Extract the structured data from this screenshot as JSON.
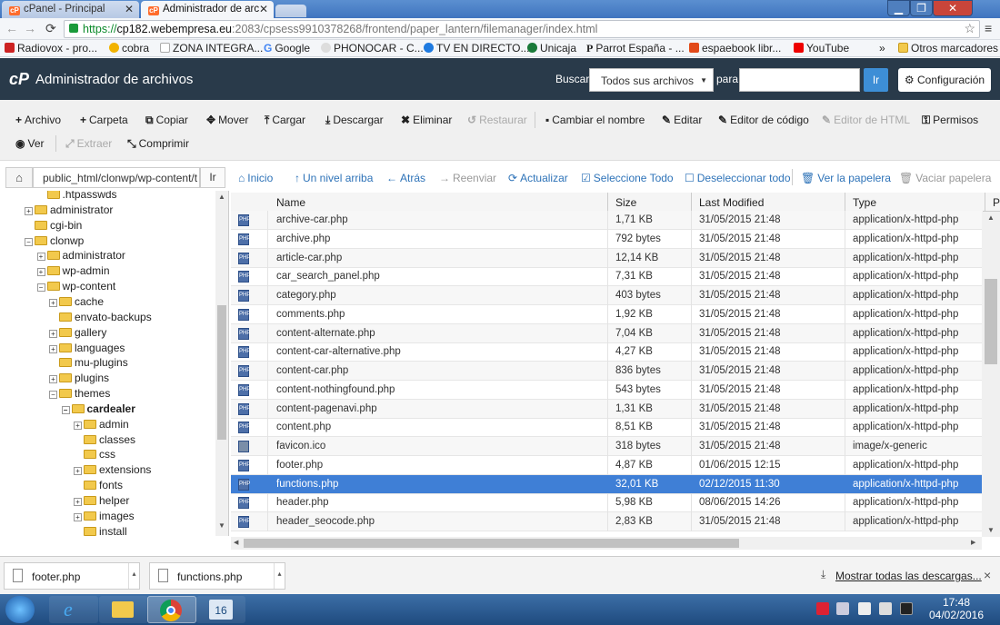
{
  "browser": {
    "tabs": [
      {
        "label": "cPanel - Principal",
        "favicon": "cP"
      },
      {
        "label": "Administrador de arc",
        "favicon": "cP"
      }
    ],
    "url_secure": "https://",
    "url_host": "cp182.webempresa.eu",
    "url_rest": ":2083/cpsess9910378268/frontend/paper_lantern/filemanager/index.html",
    "bookmarks": [
      "Radiovox - pro...",
      "cobra",
      "ZONA INTEGRA...",
      "Google",
      "PHONOCAR - C...",
      "TV EN DIRECTO...",
      "Unicaja",
      "Parrot España - ...",
      "espaebook libr...",
      "YouTube"
    ],
    "bookmarks_more": "»",
    "other_bookmarks": "Otros marcadores"
  },
  "cpanel": {
    "logo": "cP",
    "title": "Administrador de archivos",
    "search_label": "Buscar",
    "search_scope": "Todos sus archivos",
    "for_label": "para",
    "go_label": "Ir",
    "settings_label": "Configuración"
  },
  "toolbar": {
    "row1": [
      {
        "icon": "+",
        "label": "Archivo"
      },
      {
        "icon": "+",
        "label": "Carpeta"
      },
      {
        "icon": "⧉",
        "label": "Copiar"
      },
      {
        "icon": "✥",
        "label": "Mover"
      },
      {
        "icon": "⤒",
        "label": "Cargar"
      },
      {
        "icon": "⤓",
        "label": "Descargar"
      },
      {
        "icon": "✖",
        "label": "Eliminar"
      },
      {
        "icon": "↺",
        "label": "Restaurar"
      },
      {
        "icon": "▪",
        "label": "Cambiar el nombre"
      },
      {
        "icon": "✎",
        "label": "Editar"
      },
      {
        "icon": "✎",
        "label": "Editor de código"
      },
      {
        "icon": "✎",
        "label": "Editor de HTML"
      },
      {
        "icon": "⚿",
        "label": "Permisos"
      }
    ],
    "row2": [
      {
        "icon": "◉",
        "label": "Ver"
      },
      {
        "icon": "⤢",
        "label": "Extraer"
      },
      {
        "icon": "⤡",
        "label": "Comprimir"
      }
    ]
  },
  "pathbar": {
    "home_icon": "⌂",
    "path": "public_html/clonwp/wp-content/t",
    "go_label": "Ir",
    "nav": [
      {
        "icon": "⌂",
        "label": "Inicio"
      },
      {
        "icon": "↑",
        "label": "Un nivel arriba"
      },
      {
        "icon": "←",
        "label": "Atrás"
      },
      {
        "icon": "→",
        "label": "Reenviar"
      },
      {
        "icon": "⟳",
        "label": "Actualizar"
      },
      {
        "icon": "☑",
        "label": "Seleccione Todo"
      },
      {
        "icon": "☐",
        "label": "Deseleccionar todo"
      },
      {
        "icon": "🗑",
        "label": "Ver la papelera"
      },
      {
        "icon": "🗑",
        "label": "Vaciar papelera"
      }
    ]
  },
  "tree": [
    {
      "label": ".htpasswds",
      "depth": 3,
      "toggle": ""
    },
    {
      "label": "administrator",
      "depth": 2,
      "toggle": "+"
    },
    {
      "label": "cgi-bin",
      "depth": 2,
      "toggle": ""
    },
    {
      "label": "clonwp",
      "depth": 2,
      "toggle": "−"
    },
    {
      "label": "administrator",
      "depth": 3,
      "toggle": "+"
    },
    {
      "label": "wp-admin",
      "depth": 3,
      "toggle": "+"
    },
    {
      "label": "wp-content",
      "depth": 3,
      "toggle": "−"
    },
    {
      "label": "cache",
      "depth": 4,
      "toggle": "+"
    },
    {
      "label": "envato-backups",
      "depth": 4,
      "toggle": ""
    },
    {
      "label": "gallery",
      "depth": 4,
      "toggle": "+"
    },
    {
      "label": "languages",
      "depth": 4,
      "toggle": "+"
    },
    {
      "label": "mu-plugins",
      "depth": 4,
      "toggle": ""
    },
    {
      "label": "plugins",
      "depth": 4,
      "toggle": "+"
    },
    {
      "label": "themes",
      "depth": 4,
      "toggle": "−"
    },
    {
      "label": "cardealer",
      "depth": 5,
      "toggle": "−",
      "bold": true
    },
    {
      "label": "admin",
      "depth": 6,
      "toggle": "+"
    },
    {
      "label": "classes",
      "depth": 6,
      "toggle": ""
    },
    {
      "label": "css",
      "depth": 6,
      "toggle": ""
    },
    {
      "label": "extensions",
      "depth": 6,
      "toggle": "+"
    },
    {
      "label": "fonts",
      "depth": 6,
      "toggle": ""
    },
    {
      "label": "helper",
      "depth": 6,
      "toggle": "+"
    },
    {
      "label": "images",
      "depth": 6,
      "toggle": "+"
    },
    {
      "label": "install",
      "depth": 6,
      "toggle": ""
    }
  ],
  "table": {
    "columns": [
      "Name",
      "Size",
      "Last Modified",
      "Type",
      "P"
    ],
    "rows": [
      {
        "name": "archive-car.php",
        "size": "1,71 KB",
        "modified": "31/05/2015 21:48",
        "type": "application/x-httpd-php",
        "icon": "php"
      },
      {
        "name": "archive.php",
        "size": "792 bytes",
        "modified": "31/05/2015 21:48",
        "type": "application/x-httpd-php",
        "icon": "php"
      },
      {
        "name": "article-car.php",
        "size": "12,14 KB",
        "modified": "31/05/2015 21:48",
        "type": "application/x-httpd-php",
        "icon": "php"
      },
      {
        "name": "car_search_panel.php",
        "size": "7,31 KB",
        "modified": "31/05/2015 21:48",
        "type": "application/x-httpd-php",
        "icon": "php"
      },
      {
        "name": "category.php",
        "size": "403 bytes",
        "modified": "31/05/2015 21:48",
        "type": "application/x-httpd-php",
        "icon": "php"
      },
      {
        "name": "comments.php",
        "size": "1,92 KB",
        "modified": "31/05/2015 21:48",
        "type": "application/x-httpd-php",
        "icon": "php"
      },
      {
        "name": "content-alternate.php",
        "size": "7,04 KB",
        "modified": "31/05/2015 21:48",
        "type": "application/x-httpd-php",
        "icon": "php"
      },
      {
        "name": "content-car-alternative.php",
        "size": "4,27 KB",
        "modified": "31/05/2015 21:48",
        "type": "application/x-httpd-php",
        "icon": "php"
      },
      {
        "name": "content-car.php",
        "size": "836 bytes",
        "modified": "31/05/2015 21:48",
        "type": "application/x-httpd-php",
        "icon": "php"
      },
      {
        "name": "content-nothingfound.php",
        "size": "543 bytes",
        "modified": "31/05/2015 21:48",
        "type": "application/x-httpd-php",
        "icon": "php"
      },
      {
        "name": "content-pagenavi.php",
        "size": "1,31 KB",
        "modified": "31/05/2015 21:48",
        "type": "application/x-httpd-php",
        "icon": "php"
      },
      {
        "name": "content.php",
        "size": "8,51 KB",
        "modified": "31/05/2015 21:48",
        "type": "application/x-httpd-php",
        "icon": "php"
      },
      {
        "name": "favicon.ico",
        "size": "318 bytes",
        "modified": "31/05/2015 21:48",
        "type": "image/x-generic",
        "icon": "img"
      },
      {
        "name": "footer.php",
        "size": "4,87 KB",
        "modified": "01/06/2015 12:15",
        "type": "application/x-httpd-php",
        "icon": "php"
      },
      {
        "name": "functions.php",
        "size": "32,01 KB",
        "modified": "02/12/2015 11:30",
        "type": "application/x-httpd-php",
        "icon": "php",
        "selected": true
      },
      {
        "name": "header.php",
        "size": "5,98 KB",
        "modified": "08/06/2015 14:26",
        "type": "application/x-httpd-php",
        "icon": "php"
      },
      {
        "name": "header_seocode.php",
        "size": "2,83 KB",
        "modified": "31/05/2015 21:48",
        "type": "application/x-httpd-php",
        "icon": "php"
      }
    ]
  },
  "downloads": {
    "items": [
      "footer.php",
      "functions.php"
    ],
    "show_all": "Mostrar todas las descargas...",
    "close": "×"
  },
  "taskbar": {
    "time": "17:48",
    "date": "04/02/2016",
    "calendar_day": "16"
  }
}
